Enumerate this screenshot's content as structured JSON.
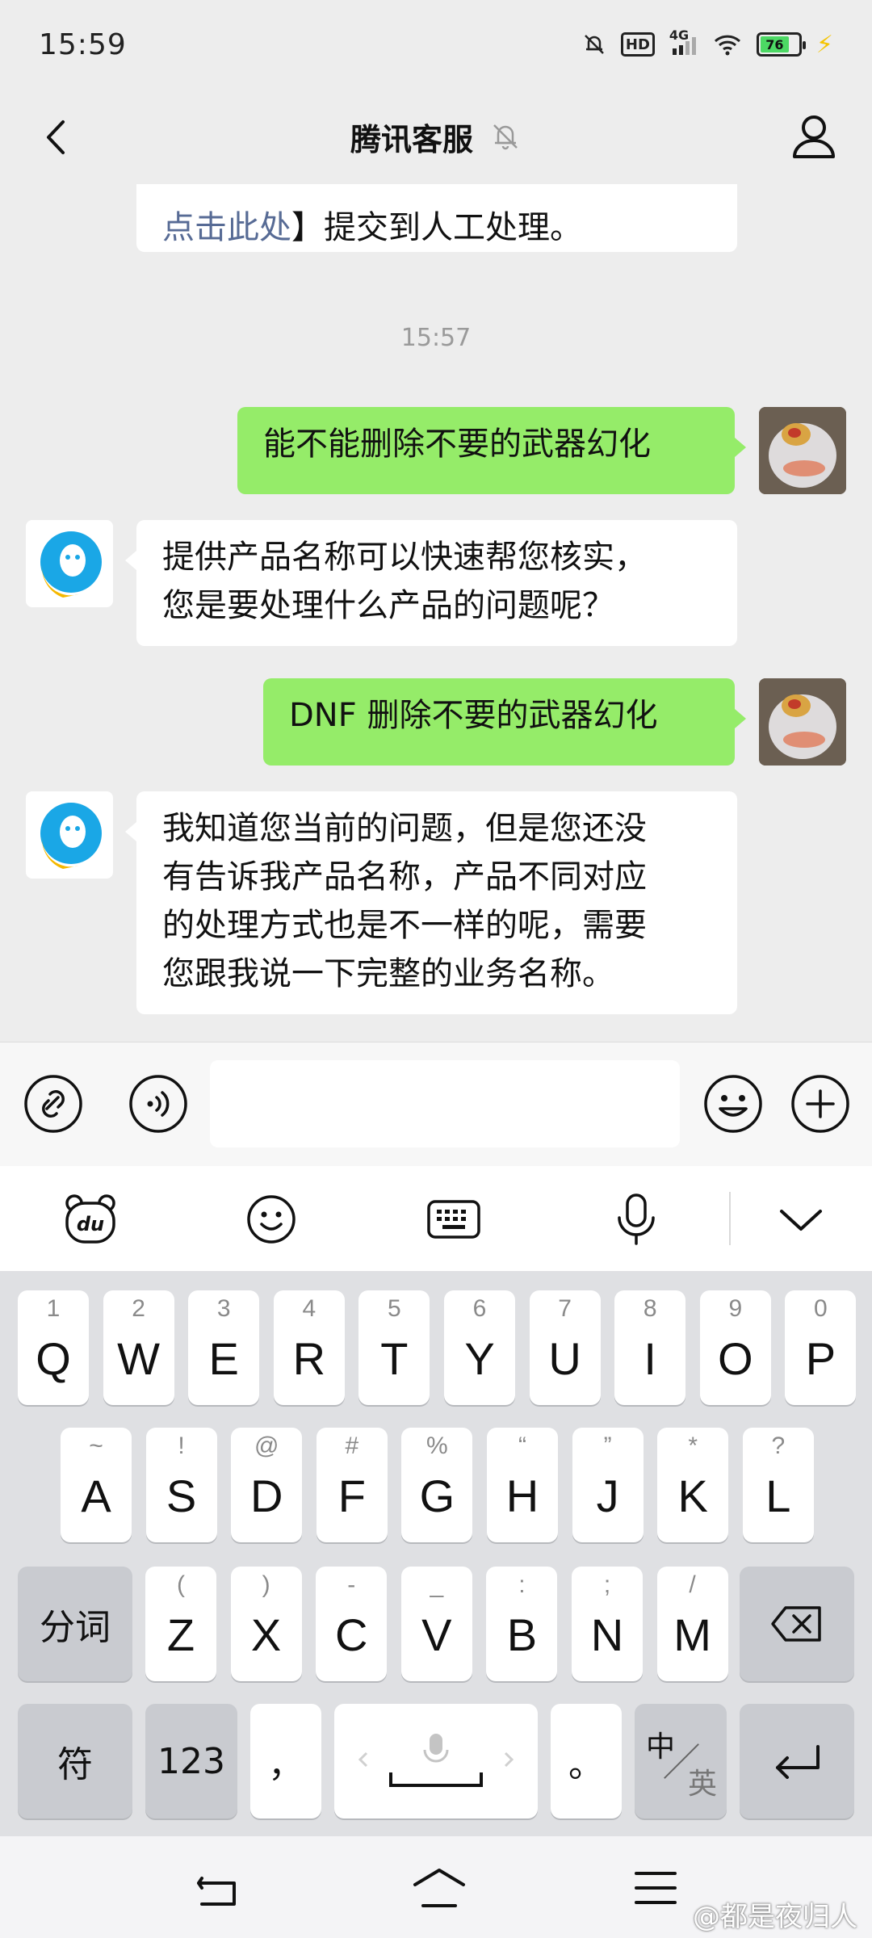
{
  "status_bar": {
    "time": "15:59",
    "network": "4G",
    "hd": "HD",
    "battery_level": "76"
  },
  "header": {
    "title": "腾讯客服",
    "back_icon": "chevron-left-icon",
    "mute_icon": "bell-off-icon",
    "profile_icon": "person-icon"
  },
  "chat": {
    "messages": [
      {
        "sender": "bot",
        "text_link": "点击此处",
        "text_after": "】提交到人工处理。"
      },
      {
        "type": "timestamp",
        "text": "15:57"
      },
      {
        "sender": "me",
        "text": "能不能删除不要的武器幻化"
      },
      {
        "sender": "bot",
        "lines": [
          "提供产品名称可以快速帮您核实，",
          "您是要处理什么产品的问题呢？"
        ]
      },
      {
        "sender": "me",
        "text": "DNF 删除不要的武器幻化"
      },
      {
        "sender": "bot",
        "lines": [
          "我知道您当前的问题，但是您还没",
          "有告诉我产品名称，产品不同对应",
          "的处理方式也是不一样的呢，需要",
          "您跟我说一下完整的业务名称。"
        ]
      }
    ]
  },
  "input_bar": {
    "message_value": "",
    "icons": [
      "link-icon",
      "voice-icon",
      "emoji-icon",
      "plus-icon"
    ]
  },
  "keyboard_toolbar": {
    "icons": [
      "du-bear-icon",
      "smiley-icon",
      "keyboard-icon",
      "microphone-icon",
      "chevron-down-icon"
    ]
  },
  "keyboard": {
    "row1": [
      {
        "main": "Q",
        "sub": "1"
      },
      {
        "main": "W",
        "sub": "2"
      },
      {
        "main": "E",
        "sub": "3"
      },
      {
        "main": "R",
        "sub": "4"
      },
      {
        "main": "T",
        "sub": "5"
      },
      {
        "main": "Y",
        "sub": "6"
      },
      {
        "main": "U",
        "sub": "7"
      },
      {
        "main": "I",
        "sub": "8"
      },
      {
        "main": "O",
        "sub": "9"
      },
      {
        "main": "P",
        "sub": "0"
      }
    ],
    "row2": [
      {
        "main": "A",
        "sub": "~"
      },
      {
        "main": "S",
        "sub": "!"
      },
      {
        "main": "D",
        "sub": "@"
      },
      {
        "main": "F",
        "sub": "#"
      },
      {
        "main": "G",
        "sub": "%"
      },
      {
        "main": "H",
        "sub": "“"
      },
      {
        "main": "J",
        "sub": "”"
      },
      {
        "main": "K",
        "sub": "*"
      },
      {
        "main": "L",
        "sub": "?"
      }
    ],
    "row3": [
      {
        "main": "Z",
        "sub": "("
      },
      {
        "main": "X",
        "sub": ")"
      },
      {
        "main": "C",
        "sub": "-"
      },
      {
        "main": "V",
        "sub": "_"
      },
      {
        "main": "B",
        "sub": ":"
      },
      {
        "main": "N",
        "sub": ";"
      },
      {
        "main": "M",
        "sub": "/"
      }
    ],
    "fenci": "分词",
    "symbols": "符",
    "numbers": "123",
    "comma": "，",
    "period": "。",
    "lang_zh": "中",
    "lang_en": "英",
    "backspace_icon": "backspace-icon",
    "enter_icon": "enter-icon"
  },
  "system_nav": {
    "icons": [
      "back-icon",
      "home-icon",
      "menu-icon"
    ],
    "watermark": "@都是夜归人"
  }
}
